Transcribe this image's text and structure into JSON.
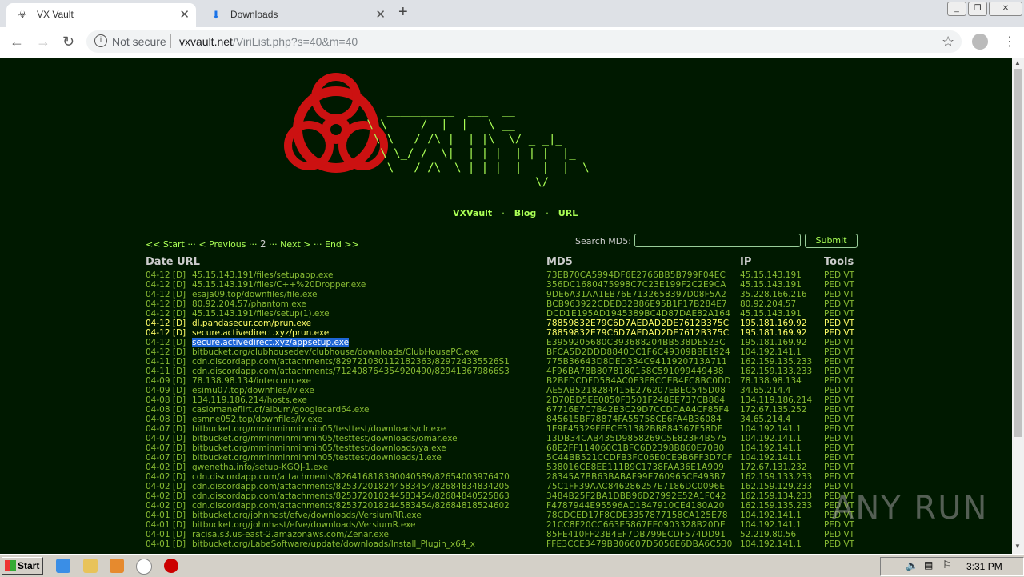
{
  "browser": {
    "tabs": [
      {
        "title": "VX Vault",
        "icon": "biohazard-icon"
      },
      {
        "title": "Downloads",
        "icon": "download-icon"
      }
    ],
    "security_label": "Not secure",
    "url_host": "vxvault.net",
    "url_path": "/ViriList.php?s=40&m=40"
  },
  "site": {
    "nav": [
      "VXVault",
      "Blog",
      "URL"
    ],
    "nav_sep": "·",
    "pager": {
      "start": "<< Start",
      "prev": "< Previous",
      "page": "2",
      "next": "Next >",
      "end": "End >>",
      "sep": "···"
    },
    "search_label": "Search MD5:",
    "search_value": "",
    "submit_label": "Submit",
    "headers": {
      "date_url": "Date URL",
      "md5": "MD5",
      "ip": "IP",
      "tools": "Tools"
    },
    "tools_text": "PED VT",
    "colors": {
      "background": "#001900",
      "link": "#88bb33",
      "highlight": "#ffff66",
      "logo_red": "#cc1111",
      "selection": "#1e66d6"
    }
  },
  "rows": [
    {
      "date": "04-12 [D]",
      "url": "45.15.143.191/files/setupapp.exe",
      "md5": "73EB70CA5994DF6E2766BB5B799F04EC",
      "ip": "45.15.143.191",
      "style": ""
    },
    {
      "date": "04-12 [D]",
      "url": "45.15.143.191/files/C++%20Dropper.exe",
      "md5": "356DC1680475998C7C23E199F2C2E9CA",
      "ip": "45.15.143.191",
      "style": ""
    },
    {
      "date": "04-12 [D]",
      "url": "esaja09.top/downfiles/file.exe",
      "md5": "9DE6A31AA1EB76E7132658397D08F5A2",
      "ip": "35.228.166.216",
      "style": ""
    },
    {
      "date": "04-12 [D]",
      "url": "80.92.204.57/phantom.exe",
      "md5": "BCB963922CDED32B86E95B1F17B284E7",
      "ip": "80.92.204.57",
      "style": ""
    },
    {
      "date": "04-12 [D]",
      "url": "45.15.143.191/files/setup(1).exe",
      "md5": "DCD1E195AD1945389BC4D87DAE82A164",
      "ip": "45.15.143.191",
      "style": ""
    },
    {
      "date": "04-12 [D]",
      "url": "dl.pandasecur.com/prun.exe",
      "md5": "78859832E79C6D7AEDAD2DE7612B375C",
      "ip": "195.181.169.92",
      "style": "hl"
    },
    {
      "date": "04-12 [D]",
      "url": "secure.activedirect.xyz/prun.exe",
      "md5": "78859832E79C6D7AEDAD2DE7612B375C",
      "ip": "195.181.169.92",
      "style": "hl"
    },
    {
      "date": "04-12 [D]",
      "url": "secure.activedirect.xyz/appsetup.exe",
      "md5": "E3959205680C393688204BB538DE523C",
      "ip": "195.181.169.92",
      "style": "sel"
    },
    {
      "date": "04-12 [D]",
      "url": "bitbucket.org/clubhousedev/clubhouse/downloads/ClubHousePC.exe",
      "md5": "BFCA5D2DDD8840DC1F6C49309BBE1924",
      "ip": "104.192.141.1",
      "style": ""
    },
    {
      "date": "04-11 [D]",
      "url": "cdn.discordapp.com/attachments/829721030112182363/829724335526S1",
      "md5": "775B36643D8DED334C9411920713A711",
      "ip": "162.159.135.233",
      "style": ""
    },
    {
      "date": "04-11 [D]",
      "url": "cdn.discordapp.com/attachments/712408764354920490/829413679866S3",
      "md5": "4F96BA78B8078180158C591099449438",
      "ip": "162.159.133.233",
      "style": ""
    },
    {
      "date": "04-09 [D]",
      "url": "78.138.98.134/intercom.exe",
      "md5": "B2BFDCDFD584AC0E3F8CCEB4FC8BC0DD",
      "ip": "78.138.98.134",
      "style": ""
    },
    {
      "date": "04-09 [D]",
      "url": "esimu07.top/downfiles/lv.exe",
      "md5": "AE5AB5218284415E276207EBEC545D08",
      "ip": "34.65.214.4",
      "style": ""
    },
    {
      "date": "04-08 [D]",
      "url": "134.119.186.214/hosts.exe",
      "md5": "2D70BD5EE0850F3501F248EE737CB884",
      "ip": "134.119.186.214",
      "style": ""
    },
    {
      "date": "04-08 [D]",
      "url": "casiomaneflirt.cf/album/googlecard64.exe",
      "md5": "67716E7C7B42B3C29D7CCDDAA4CF85F4",
      "ip": "172.67.135.252",
      "style": ""
    },
    {
      "date": "04-08 [D]",
      "url": "esmne052.top/downfiles/lv.exe",
      "md5": "845615BF78874FA55758CE6FA4B36084",
      "ip": "34.65.214.4",
      "style": ""
    },
    {
      "date": "04-07 [D]",
      "url": "bitbucket.org/mminminminmin05/testtest/downloads/clr.exe",
      "md5": "1E9F45329FFECE31382BB884367F58DF",
      "ip": "104.192.141.1",
      "style": ""
    },
    {
      "date": "04-07 [D]",
      "url": "bitbucket.org/mminminminmin05/testtest/downloads/omar.exe",
      "md5": "13DB34CAB435D9858269C5E823F4B575",
      "ip": "104.192.141.1",
      "style": ""
    },
    {
      "date": "04-07 [D]",
      "url": "bitbucket.org/mminminminmin05/testtest/downloads/ya.exe",
      "md5": "68E2FF114060C1BFC6D2398B860E70B0",
      "ip": "104.192.141.1",
      "style": ""
    },
    {
      "date": "04-07 [D]",
      "url": "bitbucket.org/mminminminmin05/testtest/downloads/1.exe",
      "md5": "5C44BB521CCDFB3FC06E0CE9B6FF3D7CF",
      "ip": "104.192.141.1",
      "style": ""
    },
    {
      "date": "04-02 [D]",
      "url": "gwenetha.info/setup-KGQJ-1.exe",
      "md5": "538016CE8EE111B9C1738FAA36E1A909",
      "ip": "172.67.131.232",
      "style": ""
    },
    {
      "date": "04-02 [D]",
      "url": "cdn.discordapp.com/attachments/826416818390040589/82654003976470",
      "md5": "28345A7BB63BABAF99E760965CE493B7",
      "ip": "162.159.133.233",
      "style": ""
    },
    {
      "date": "04-02 [D]",
      "url": "cdn.discordapp.com/attachments/825372018244583454/82684834834205",
      "md5": "75C1FF39AAC846286257E7186DC0096E",
      "ip": "162.159.129.233",
      "style": ""
    },
    {
      "date": "04-02 [D]",
      "url": "cdn.discordapp.com/attachments/825372018244583454/82684840525863",
      "md5": "3484B25F2BA1DBB96D27992E52A1F042",
      "ip": "162.159.134.233",
      "style": ""
    },
    {
      "date": "04-02 [D]",
      "url": "cdn.discordapp.com/attachments/825372018244583454/82684818524602",
      "md5": "F4787944E95596AD1847910CE4180A20",
      "ip": "162.159.135.233",
      "style": ""
    },
    {
      "date": "04-01 [D]",
      "url": "bitbucket.org/johnhast/efve/downloads/VersiumRR.exe",
      "md5": "78CDCED17F8CDE3357877158CA125E78",
      "ip": "104.192.141.1",
      "style": ""
    },
    {
      "date": "04-01 [D]",
      "url": "bitbucket.org/johnhast/efve/downloads/VersiumR.exe",
      "md5": "21CC8F20CC663E5867EE0903328B20DE",
      "ip": "104.192.141.1",
      "style": ""
    },
    {
      "date": "04-01 [D]",
      "url": "racisa.s3.us-east-2.amazonaws.com/Zenar.exe",
      "md5": "85FE410FF23B4EF7DB799ECDF574DD91",
      "ip": "52.219.80.56",
      "style": ""
    },
    {
      "date": "04-01 [D]",
      "url": "bitbucket.org/LabeSoftware/update/downloads/Install_Plugin_x64_x",
      "md5": "FFE3CCE3479BB06607D5056E6DBA6C530",
      "ip": "104.192.141.1",
      "style": ""
    }
  ],
  "watermark": "ANY RUN",
  "taskbar": {
    "start_label": "Start",
    "clock": "3:31 PM"
  }
}
